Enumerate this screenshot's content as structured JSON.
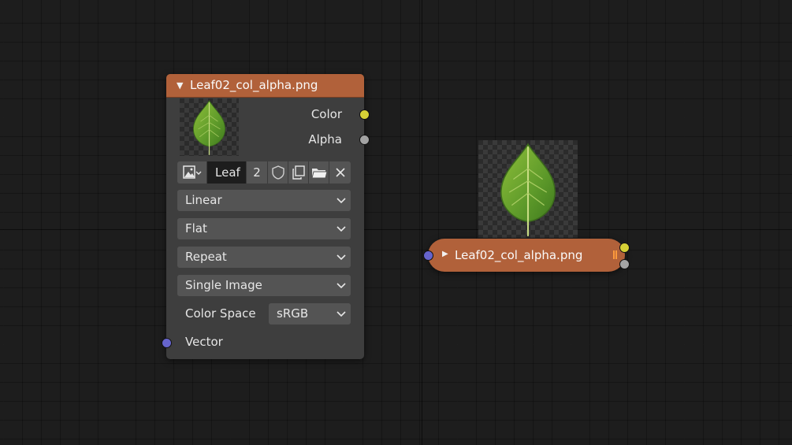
{
  "node": {
    "header_title": "Leaf02_col_alpha.png",
    "outputs": {
      "color": "Color",
      "alpha": "Alpha"
    },
    "image_selector": {
      "image_name": "Leaf",
      "users_count": "2"
    },
    "interpolation": "Linear",
    "projection": "Flat",
    "extension": "Repeat",
    "source": "Single Image",
    "color_space": {
      "label": "Color Space",
      "value": "sRGB"
    },
    "inputs": {
      "vector": "Vector"
    }
  },
  "collapsed_node": {
    "title": "Leaf02_col_alpha.png"
  },
  "colors": {
    "header": "#b1613a",
    "node_body": "#3e3e3e",
    "socket_color": "#d6d136",
    "socket_alpha": "#a3a3a3",
    "socket_vector": "#6664cc",
    "background": "#1d1d1d"
  },
  "icons": [
    "expand-triangle-icon",
    "image-type-icon",
    "fake-user-shield-icon",
    "duplicate-icon",
    "open-folder-icon",
    "close-icon",
    "chevron-down-icon",
    "collapsed-triangle-icon"
  ]
}
